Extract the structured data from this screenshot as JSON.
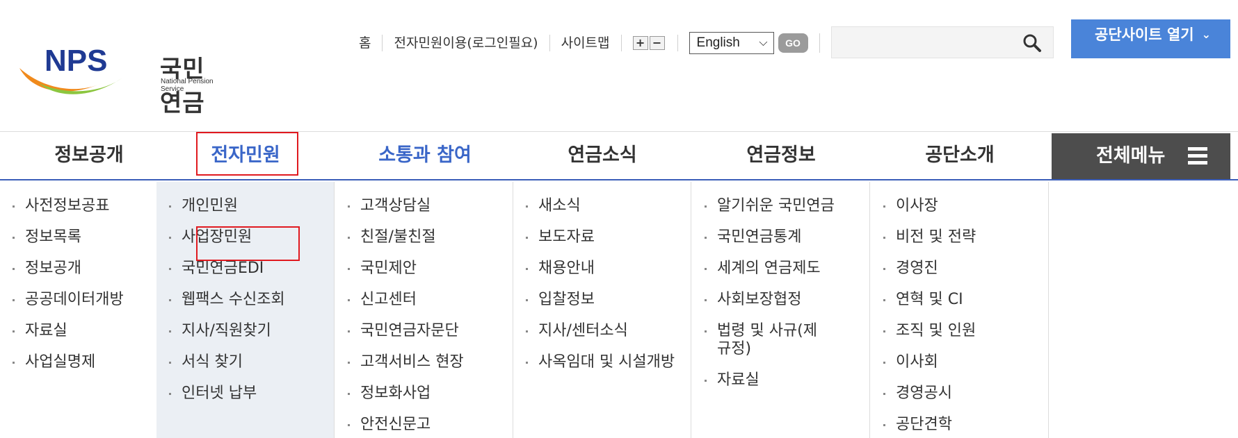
{
  "logo": {
    "mark": "NPS",
    "name_ko": "국민연금",
    "name_en": "National Pension Service"
  },
  "util_links": [
    "홈",
    "전자민원이용(로그인필요)",
    "사이트맵"
  ],
  "zoom": {
    "in": "+",
    "out": "−"
  },
  "language": {
    "selected": "English",
    "go": "GO"
  },
  "search": {
    "placeholder": ""
  },
  "site_open": {
    "label": "공단사이트 열기",
    "chevron": "⌄"
  },
  "gnb": {
    "items": [
      "정보공개",
      "전자민원",
      "소통과 참여",
      "연금소식",
      "연금정보",
      "공단소개"
    ],
    "all_menu": "전체메뉴"
  },
  "submenu": [
    [
      "사전정보공표",
      "정보목록",
      "정보공개",
      "공공데이터개방",
      "자료실",
      "사업실명제"
    ],
    [
      "개인민원",
      "사업장민원",
      "국민연금EDI",
      "웹팩스 수신조회",
      "지사/직원찾기",
      "서식 찾기",
      "인터넷 납부"
    ],
    [
      "고객상담실",
      "친절/불친절",
      "국민제안",
      "신고센터",
      "국민연금자문단",
      "고객서비스 현장",
      "정보화사업",
      "안전신문고"
    ],
    [
      "새소식",
      "보도자료",
      "채용안내",
      "입찰정보",
      "지사/센터소식",
      "사옥임대 및 시설개방"
    ],
    [
      "알기쉬운 국민연금",
      "국민연금통계",
      "세계의 연금제도",
      "사회보장협정",
      "법령 및 사규(제규정)",
      "자료실"
    ],
    [
      "이사장",
      "비전 및 전략",
      "경영진",
      "연혁 및 CI",
      "조직 및 인원",
      "이사회",
      "경영공시",
      "공단견학"
    ]
  ],
  "colors": {
    "accent_blue": "#3a66c8",
    "button_blue": "#4a84d9",
    "highlight_red": "#e0191f",
    "all_menu_bg": "#4d4d4d",
    "active_col_bg": "#ebeff4"
  }
}
